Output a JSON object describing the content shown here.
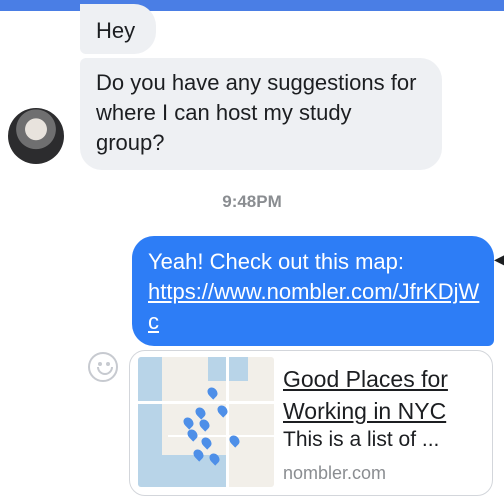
{
  "colors": {
    "topbar": "#4a7ee5",
    "incoming_bubble": "#eef0f3",
    "outgoing_bubble": "#2d7df6",
    "timestamp": "#8a8d91"
  },
  "messages": {
    "incoming": [
      {
        "text": "Hey"
      },
      {
        "text": "Do you have any suggestions for where I can host my study group?"
      }
    ],
    "timestamp": "9:48PM",
    "outgoing": {
      "text": "Yeah! Check out this map:",
      "link": "https://www.nombler.com/JfrKDjWc"
    }
  },
  "link_preview": {
    "title": "Good Places for Working in NYC",
    "description": "This is a list of ...",
    "domain": "nombler.com"
  },
  "icons": {
    "avatar": "user-avatar",
    "reaction": "smiley-icon",
    "status": "caret-left-icon"
  }
}
